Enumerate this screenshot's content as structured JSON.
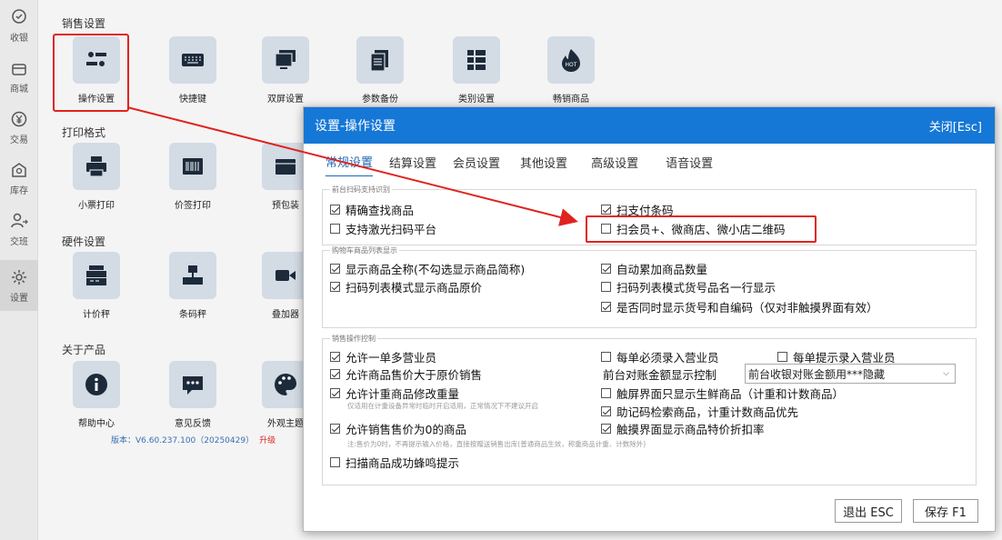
{
  "nav": {
    "items": [
      {
        "label": "收银",
        "icon": "cashier-icon"
      },
      {
        "label": "商城",
        "icon": "store-icon"
      },
      {
        "label": "交易",
        "icon": "yen-icon"
      },
      {
        "label": "库存",
        "icon": "inventory-icon"
      },
      {
        "label": "交班",
        "icon": "shift-icon"
      },
      {
        "label": "设置",
        "icon": "gear-icon"
      }
    ]
  },
  "sections": {
    "sales": {
      "title": "销售设置",
      "tiles": [
        {
          "label": "操作设置",
          "icon": "sliders-icon"
        },
        {
          "label": "快捷键",
          "icon": "keyboard-icon"
        },
        {
          "label": "双屏设置",
          "icon": "dual-screen-icon"
        },
        {
          "label": "参数备份",
          "icon": "backup-icon"
        },
        {
          "label": "类别设置",
          "icon": "category-icon"
        },
        {
          "label": "畅销商品",
          "icon": "hot-icon",
          "badge": "HOT"
        }
      ]
    },
    "print": {
      "title": "打印格式",
      "tiles": [
        {
          "label": "小票打印",
          "icon": "printer-icon"
        },
        {
          "label": "价签打印",
          "icon": "barcode-label-icon"
        },
        {
          "label": "预包装",
          "icon": "package-icon"
        }
      ]
    },
    "hardware": {
      "title": "硬件设置",
      "tiles": [
        {
          "label": "计价秤",
          "icon": "pricing-scale-icon"
        },
        {
          "label": "条码秤",
          "icon": "barcode-scale-icon"
        },
        {
          "label": "叠加器",
          "icon": "video-icon"
        }
      ]
    },
    "about": {
      "title": "关于产品",
      "tiles": [
        {
          "label": "帮助中心",
          "icon": "info-icon"
        },
        {
          "label": "意见反馈",
          "icon": "feedback-icon"
        },
        {
          "label": "外观主题",
          "icon": "palette-icon"
        }
      ]
    }
  },
  "version": {
    "text": "版本：V6.60.237.100（20250429）",
    "upgrade": "升级"
  },
  "dialog": {
    "title": "设置-操作设置",
    "close": "关闭[Esc]",
    "tabs": [
      "常规设置",
      "结算设置",
      "会员设置",
      "其他设置",
      "高级设置",
      "语音设置"
    ],
    "active_tab": 0,
    "group1": {
      "legend": "前台扫码支持识别",
      "options": [
        {
          "label": "精确查找商品",
          "checked": true
        },
        {
          "label": "扫支付条码",
          "checked": true
        },
        {
          "label": "支持激光扫码平台",
          "checked": false
        },
        {
          "label": "扫会员+、微商店、微小店二维码",
          "checked": false
        }
      ]
    },
    "group2": {
      "legend": "购物车商品列表显示",
      "options": [
        {
          "label": "显示商品全称(不勾选显示商品简称)",
          "checked": true
        },
        {
          "label": "自动累加商品数量",
          "checked": true
        },
        {
          "label": "扫码列表模式显示商品原价",
          "checked": true
        },
        {
          "label": "扫码列表模式货号品名一行显示",
          "checked": false
        },
        {
          "label": "是否同时显示货号和自编码（仅对非触摸界面有效）",
          "checked": true
        }
      ]
    },
    "group3": {
      "legend": "销售操作控制",
      "options": [
        {
          "label": "允许一单多营业员",
          "checked": true
        },
        {
          "label": "每单必须录入营业员",
          "checked": false
        },
        {
          "label": "每单提示录入营业员",
          "checked": false
        },
        {
          "label": "允许商品售价大于原价销售",
          "checked": true
        },
        {
          "label": "允许计重商品修改重量",
          "checked": true
        },
        {
          "label": "触屏界面只显示生鲜商品（计重和计数商品）",
          "checked": false
        },
        {
          "label": "助记码检索商品，计重计数商品优先",
          "checked": true
        },
        {
          "label": "允许销售售价为0的商品",
          "checked": true
        },
        {
          "label": "触摸界面显示商品特价折扣率",
          "checked": true
        },
        {
          "label": "扫描商品成功蜂鸣提示",
          "checked": false
        }
      ],
      "account_label": "前台对账金额显示控制",
      "account_value": "前台收银对账金额用***隐藏",
      "note_weight": "仅适用在计重设备异常时临时开启适用，正常情况下不建议开启",
      "note_zero": "注:售价为0时，不再提示输入价格，直接按赠送销售出库(普通商品生效，称重商品计重、计数除外)"
    },
    "buttons": {
      "exit": "退出 ESC",
      "save": "保存 F1"
    }
  }
}
